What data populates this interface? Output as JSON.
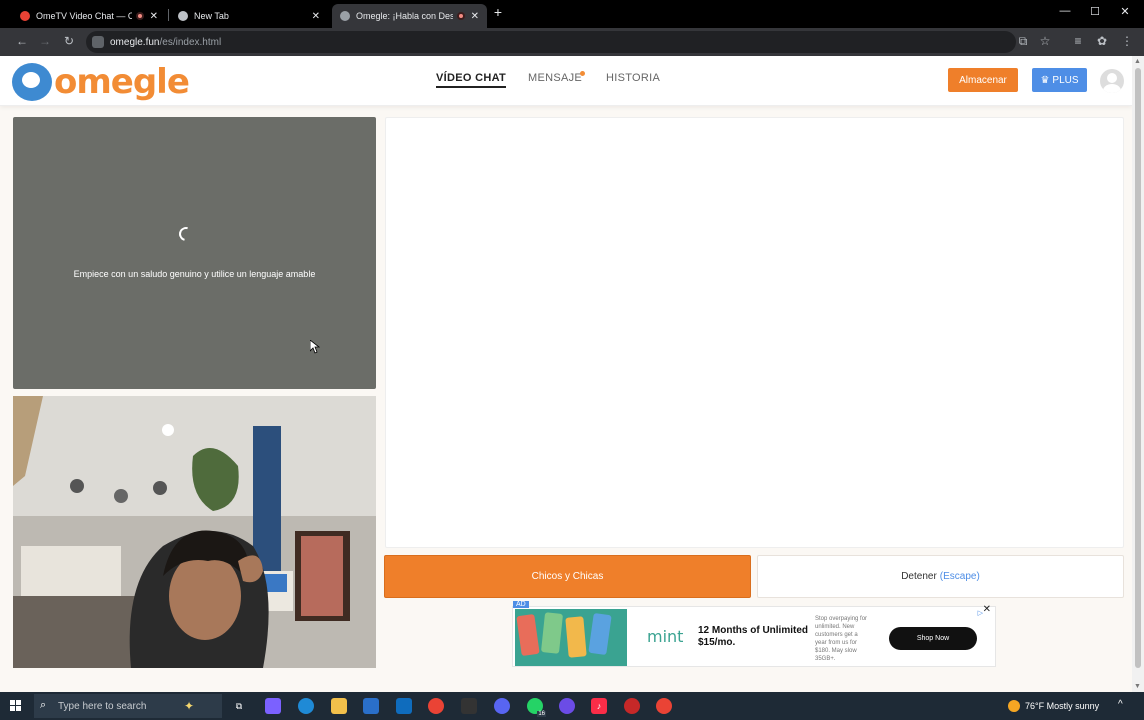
{
  "browser": {
    "tabs": [
      {
        "title": "OmeTV Video Chat — Ome",
        "active": false,
        "recording": true,
        "favicon_color": "#ea4335"
      },
      {
        "title": "New Tab",
        "active": false,
        "recording": false,
        "favicon_color": "#bdc1c6"
      },
      {
        "title": "Omegle: ¡Habla con Desco",
        "active": true,
        "recording": true,
        "favicon_color": "#9aa0a6"
      }
    ],
    "new_tab_icon": "plus-icon",
    "url_host": "omegle.fun",
    "url_path": "/es/index.html"
  },
  "site": {
    "logo_text": "omegle",
    "nav": [
      {
        "label": "VÍDEO CHAT",
        "active": true
      },
      {
        "label": "MENSAJE",
        "active": false,
        "notification_dot": true
      },
      {
        "label": "HISTORIA",
        "active": false
      }
    ],
    "store_label": "Almacenar",
    "plus_label": "PLUS",
    "accent_color": "#ef7f2a",
    "plus_color": "#4e8ee6"
  },
  "stranger_video": {
    "hint": "Empiece con un saludo genuino y utilice un lenguaje amable"
  },
  "controls": {
    "new_chat_label": "Chicos y Chicas",
    "stop_label": "Detener",
    "stop_shortcut": "(Escape)"
  },
  "ad": {
    "tag": "AD",
    "brand": "mint",
    "headline": "12 Months of Unlimited $15/mo.",
    "fine_print": "Stop overpaying for unlimited. New customers get a year from us for $180. May slow 35GB+.",
    "cta": "Shop Now"
  },
  "taskbar": {
    "search_placeholder": "Type here to search",
    "weather_temp": "76°F",
    "weather_text": "Mostly sunny",
    "whatsapp_badge": "16"
  }
}
